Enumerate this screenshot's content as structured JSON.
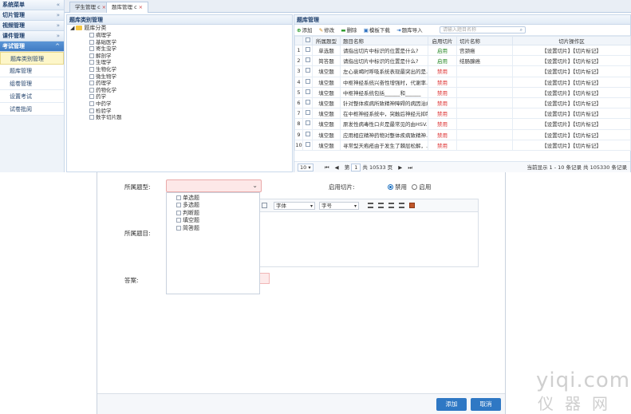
{
  "sidebar": {
    "groups": [
      {
        "label": "系统菜单",
        "chevron": "«"
      },
      {
        "label": "切片管理",
        "chevron": "»"
      },
      {
        "label": "视频管理",
        "chevron": "»"
      },
      {
        "label": "课件管理",
        "chevron": "»"
      },
      {
        "label": "考试管理",
        "chevron": "^"
      }
    ],
    "items": [
      "题库类别管理",
      "题库管理",
      "组卷管理",
      "设置考试",
      "试卷批阅"
    ]
  },
  "tabs": [
    {
      "label": "学生管理",
      "refresh": "c",
      "close": "×"
    },
    {
      "label": "题库管理",
      "refresh": "c",
      "close": "×"
    }
  ],
  "tree": {
    "title": "题库类别管理",
    "root": "题库分类",
    "nodes": [
      "病理学",
      "基础医学",
      "寄生虫学",
      "解剖学",
      "生理学",
      "生物化学",
      "微生物学",
      "药理学",
      "药物化学",
      "药学",
      "中药学",
      "检验学",
      "数字切片题"
    ]
  },
  "grid": {
    "title": "题库管理",
    "toolbar": {
      "add": "添加",
      "edit": "修改",
      "delete": "删除",
      "download": "模板下载",
      "import": "题库导入",
      "search_placeholder": "请输入题目名称"
    },
    "columns": [
      "所属题型",
      "题目名称",
      "启用切片",
      "切片名称",
      "切片操作区"
    ],
    "rows": [
      {
        "n": "1",
        "type": "单选题",
        "title": "请指出切片中标识的位置是什么?",
        "status": "启用",
        "slice": "宫颈癌",
        "ops": "【设置切片】【切片标记】"
      },
      {
        "n": "2",
        "type": "简答题",
        "title": "请指出切片中标识的位置是什么?",
        "status": "启用",
        "slice": "结肠腺癌",
        "ops": "【设置切片】【切片标记】"
      },
      {
        "n": "3",
        "type": "填空题",
        "title": "左心衰竭时呼吸系统表现最突出的是...",
        "status": "禁用",
        "slice": "",
        "ops": "【设置切片】【切片标记】"
      },
      {
        "n": "4",
        "type": "填空题",
        "title": "中枢神经系统兴奋性增强时，代谢率...",
        "status": "禁用",
        "slice": "",
        "ops": "【设置切片】【切片标记】"
      },
      {
        "n": "5",
        "type": "填空题",
        "title": "中枢神经系统包括______和______",
        "status": "禁用",
        "slice": "",
        "ops": "【设置切片】【切片标记】"
      },
      {
        "n": "6",
        "type": "填空题",
        "title": "针对整体疾病所致精神障碍的病因治疗...",
        "status": "禁用",
        "slice": "",
        "ops": "【设置切片】【切片标记】"
      },
      {
        "n": "7",
        "type": "填空题",
        "title": "在中枢神经系统中，突触后神经元抑制...",
        "status": "禁用",
        "slice": "",
        "ops": "【设置切片】【切片标记】"
      },
      {
        "n": "8",
        "type": "填空题",
        "title": "原发性病毒性口炎是最常见的由HSV...",
        "status": "禁用",
        "slice": "",
        "ops": "【设置切片】【切片标记】"
      },
      {
        "n": "9",
        "type": "填空题",
        "title": "应用相应精神药物对整体疾病致精神...",
        "status": "禁用",
        "slice": "",
        "ops": "【设置切片】【切片标记】"
      },
      {
        "n": "10",
        "type": "填空题",
        "title": "寻常型天疱疮由于发生了棘层松解，...",
        "status": "禁用",
        "slice": "",
        "ops": "【设置切片】【切片标记】"
      }
    ],
    "pager": {
      "page_size": "10",
      "page": "1",
      "page_prefix": "第",
      "total_pages": "共 10533 页",
      "info": "当前显示 1 - 10 条记录 共 105330 条记录"
    }
  },
  "dialog": {
    "type_label": "所属题型:",
    "type_options": [
      "单选题",
      "多选题",
      "判断题",
      "填空题",
      "简答题"
    ],
    "slice_label": "启用切片:",
    "radio_disable": "禁用",
    "radio_enable": "启用",
    "question_label": "所属题目:",
    "answer_label": "答案:",
    "font_select": "字体",
    "size_select": "字号",
    "btn_add": "添加",
    "btn_cancel": "取消"
  },
  "watermark": {
    "line1": "yiqi.com",
    "line2": "仪器网"
  },
  "colors": {
    "primary": "#2f78c4",
    "enabled": "#2a8a2a",
    "disabled": "#d33333",
    "header_active": "#3f7bc3"
  }
}
